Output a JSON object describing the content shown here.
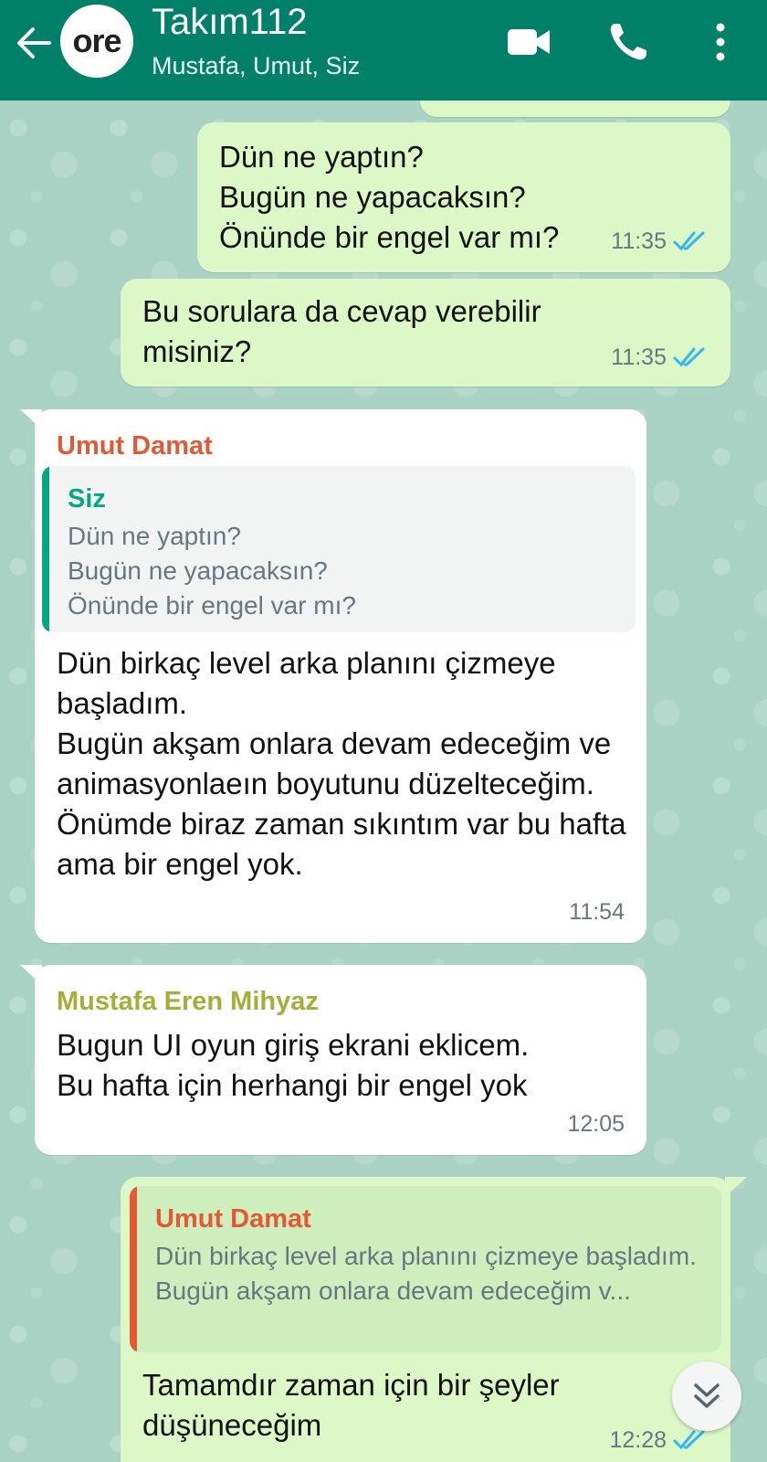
{
  "header": {
    "avatar_text": "ore",
    "title": "Takım112",
    "subtitle": "Mustafa, Umut, Siz",
    "icons": [
      "back-arrow-icon",
      "video-call-icon",
      "phone-icon",
      "more-vert-icon"
    ]
  },
  "colors": {
    "header_bg": "#008069",
    "outgoing_bubble": "#dcf8c6",
    "incoming_bubble": "#ffffff",
    "read_check": "#34b7f1",
    "sender_umut": "#e25a33",
    "sender_mustafa": "#a5ae3a",
    "quote_bar_self": "#06a884"
  },
  "messages": [
    {
      "direction": "out",
      "text": "Dün ne yaptın?\nBugün ne yapacaksın?\nÖnünde bir engel var mı?",
      "time": "11:35",
      "status": "read"
    },
    {
      "direction": "out",
      "text": "Bu sorulara da cevap verebilir misiniz?",
      "time": "11:35",
      "status": "read"
    },
    {
      "direction": "in",
      "sender": "Umut Damat",
      "quote": {
        "sender": "Siz",
        "text": "Dün ne yaptın?\nBugün ne yapacaksın?\nÖnünde bir engel var mı?"
      },
      "text": "Dün birkaç level arka planını çizmeye başladım.\nBugün akşam onlara devam edeceğim ve animasyonlaeın boyutunu düzelteceğim.\nÖnümde biraz zaman sıkıntım var bu hafta ama bir engel yok.",
      "time": "11:54"
    },
    {
      "direction": "in",
      "sender": "Mustafa Eren Mihyaz",
      "text": "Bugun UI oyun giriş ekrani eklicem.\nBu hafta için herhangi bir engel yok",
      "time": "12:05"
    },
    {
      "direction": "out",
      "quote": {
        "sender": "Umut Damat",
        "text": "Dün birkaç level arka planını çizmeye başladım.\nBugün akşam onlara devam edeceğim v..."
      },
      "text": "Tamamdır zaman için bir şeyler düşüneceğim",
      "time": "12:28",
      "status": "read"
    }
  ]
}
